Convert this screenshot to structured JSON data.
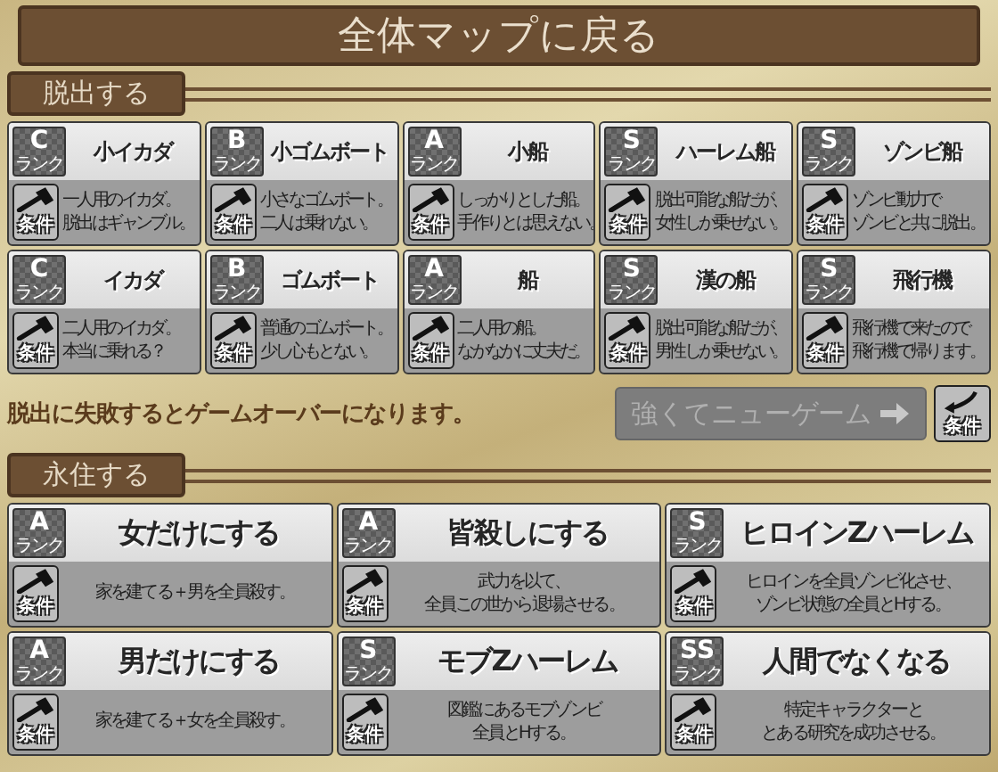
{
  "back_button": {
    "label": "全体マップに戻る"
  },
  "escape_section": {
    "title": "脱出する",
    "endings": [
      {
        "rank": "C",
        "rank_label": "ランク",
        "title": "小イカダ",
        "condition_label": "条件",
        "description": [
          "一人用のイカダ。",
          "脱出はギャンブル。"
        ]
      },
      {
        "rank": "B",
        "rank_label": "ランク",
        "title": "小ゴムボート",
        "condition_label": "条件",
        "description": [
          "小さなゴムボート。",
          "二人は乗れない。"
        ]
      },
      {
        "rank": "A",
        "rank_label": "ランク",
        "title": "小船",
        "condition_label": "条件",
        "description": [
          "しっかりとした船。",
          "手作りとは思えない。"
        ]
      },
      {
        "rank": "S",
        "rank_label": "ランク",
        "title": "ハーレム船",
        "condition_label": "条件",
        "description": [
          "脱出可能な船だが、",
          "女性しか乗せない。"
        ]
      },
      {
        "rank": "S",
        "rank_label": "ランク",
        "title": "ゾンビ船",
        "condition_label": "条件",
        "description": [
          "ゾンビ動力で",
          "ゾンビと共に脱出。"
        ]
      },
      {
        "rank": "C",
        "rank_label": "ランク",
        "title": "イカダ",
        "condition_label": "条件",
        "description": [
          "二人用のイカダ。",
          "本当に乗れる？"
        ]
      },
      {
        "rank": "B",
        "rank_label": "ランク",
        "title": "ゴムボート",
        "condition_label": "条件",
        "description": [
          "普通のゴムボート。",
          "少し心もとない。"
        ]
      },
      {
        "rank": "A",
        "rank_label": "ランク",
        "title": "船",
        "condition_label": "条件",
        "description": [
          "二人用の船。",
          "なかなかに丈夫だ。"
        ]
      },
      {
        "rank": "S",
        "rank_label": "ランク",
        "title": "漢の船",
        "condition_label": "条件",
        "description": [
          "脱出可能な船だが、",
          "男性しか乗せない。"
        ]
      },
      {
        "rank": "S",
        "rank_label": "ランク",
        "title": "飛行機",
        "condition_label": "条件",
        "description": [
          "飛行機で来たので",
          "飛行機で帰ります。"
        ]
      }
    ],
    "note": "脱出に失敗するとゲームオーバーになります。",
    "new_game_button": {
      "label": "強くてニューゲーム",
      "disabled": true
    },
    "new_game_condition": {
      "label": "条件"
    }
  },
  "permanent_section": {
    "title": "永住する",
    "endings": [
      {
        "rank": "A",
        "rank_label": "ランク",
        "title": "女だけにする",
        "condition_label": "条件",
        "description": [
          "家を建てる＋男を全員殺す。"
        ]
      },
      {
        "rank": "A",
        "rank_label": "ランク",
        "title": "皆殺しにする",
        "condition_label": "条件",
        "description": [
          "武力を以て、",
          "全員この世から退場させる。"
        ]
      },
      {
        "rank": "S",
        "rank_label": "ランク",
        "title": "ヒロインZハーレム",
        "condition_label": "条件",
        "description": [
          "ヒロインを全員ゾンビ化させ、",
          "ゾンビ状態の全員とHする。"
        ]
      },
      {
        "rank": "A",
        "rank_label": "ランク",
        "title": "男だけにする",
        "condition_label": "条件",
        "description": [
          "家を建てる＋女を全員殺す。"
        ]
      },
      {
        "rank": "S",
        "rank_label": "ランク",
        "title": "モブZハーレム",
        "condition_label": "条件",
        "description": [
          "図鑑にあるモブゾンビ",
          "全員とHする。"
        ]
      },
      {
        "rank": "SS",
        "rank_label": "ランク",
        "title": "人間でなくなる",
        "condition_label": "条件",
        "description": [
          "特定キャラクターと",
          "とある研究を成功させる。"
        ]
      }
    ]
  }
}
